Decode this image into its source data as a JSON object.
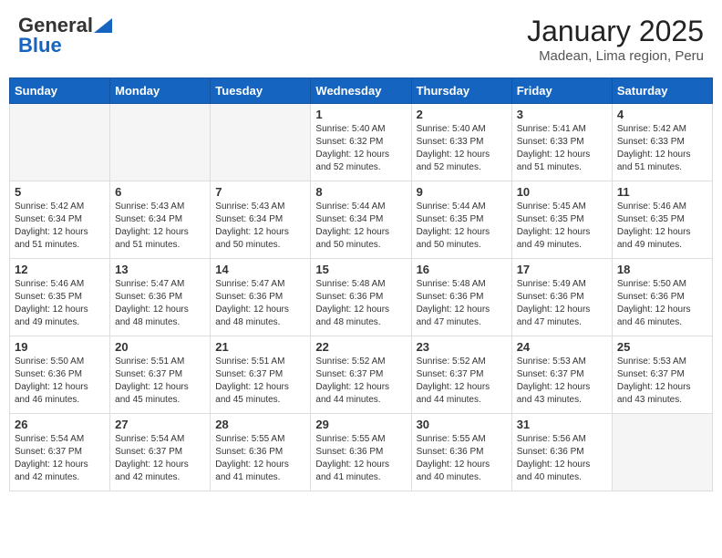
{
  "header": {
    "logo_general": "General",
    "logo_blue": "Blue",
    "month": "January 2025",
    "location": "Madean, Lima region, Peru"
  },
  "weekdays": [
    "Sunday",
    "Monday",
    "Tuesday",
    "Wednesday",
    "Thursday",
    "Friday",
    "Saturday"
  ],
  "weeks": [
    [
      {
        "day": "",
        "info": ""
      },
      {
        "day": "",
        "info": ""
      },
      {
        "day": "",
        "info": ""
      },
      {
        "day": "1",
        "info": "Sunrise: 5:40 AM\nSunset: 6:32 PM\nDaylight: 12 hours\nand 52 minutes."
      },
      {
        "day": "2",
        "info": "Sunrise: 5:40 AM\nSunset: 6:33 PM\nDaylight: 12 hours\nand 52 minutes."
      },
      {
        "day": "3",
        "info": "Sunrise: 5:41 AM\nSunset: 6:33 PM\nDaylight: 12 hours\nand 51 minutes."
      },
      {
        "day": "4",
        "info": "Sunrise: 5:42 AM\nSunset: 6:33 PM\nDaylight: 12 hours\nand 51 minutes."
      }
    ],
    [
      {
        "day": "5",
        "info": "Sunrise: 5:42 AM\nSunset: 6:34 PM\nDaylight: 12 hours\nand 51 minutes."
      },
      {
        "day": "6",
        "info": "Sunrise: 5:43 AM\nSunset: 6:34 PM\nDaylight: 12 hours\nand 51 minutes."
      },
      {
        "day": "7",
        "info": "Sunrise: 5:43 AM\nSunset: 6:34 PM\nDaylight: 12 hours\nand 50 minutes."
      },
      {
        "day": "8",
        "info": "Sunrise: 5:44 AM\nSunset: 6:34 PM\nDaylight: 12 hours\nand 50 minutes."
      },
      {
        "day": "9",
        "info": "Sunrise: 5:44 AM\nSunset: 6:35 PM\nDaylight: 12 hours\nand 50 minutes."
      },
      {
        "day": "10",
        "info": "Sunrise: 5:45 AM\nSunset: 6:35 PM\nDaylight: 12 hours\nand 49 minutes."
      },
      {
        "day": "11",
        "info": "Sunrise: 5:46 AM\nSunset: 6:35 PM\nDaylight: 12 hours\nand 49 minutes."
      }
    ],
    [
      {
        "day": "12",
        "info": "Sunrise: 5:46 AM\nSunset: 6:35 PM\nDaylight: 12 hours\nand 49 minutes."
      },
      {
        "day": "13",
        "info": "Sunrise: 5:47 AM\nSunset: 6:36 PM\nDaylight: 12 hours\nand 48 minutes."
      },
      {
        "day": "14",
        "info": "Sunrise: 5:47 AM\nSunset: 6:36 PM\nDaylight: 12 hours\nand 48 minutes."
      },
      {
        "day": "15",
        "info": "Sunrise: 5:48 AM\nSunset: 6:36 PM\nDaylight: 12 hours\nand 48 minutes."
      },
      {
        "day": "16",
        "info": "Sunrise: 5:48 AM\nSunset: 6:36 PM\nDaylight: 12 hours\nand 47 minutes."
      },
      {
        "day": "17",
        "info": "Sunrise: 5:49 AM\nSunset: 6:36 PM\nDaylight: 12 hours\nand 47 minutes."
      },
      {
        "day": "18",
        "info": "Sunrise: 5:50 AM\nSunset: 6:36 PM\nDaylight: 12 hours\nand 46 minutes."
      }
    ],
    [
      {
        "day": "19",
        "info": "Sunrise: 5:50 AM\nSunset: 6:36 PM\nDaylight: 12 hours\nand 46 minutes."
      },
      {
        "day": "20",
        "info": "Sunrise: 5:51 AM\nSunset: 6:37 PM\nDaylight: 12 hours\nand 45 minutes."
      },
      {
        "day": "21",
        "info": "Sunrise: 5:51 AM\nSunset: 6:37 PM\nDaylight: 12 hours\nand 45 minutes."
      },
      {
        "day": "22",
        "info": "Sunrise: 5:52 AM\nSunset: 6:37 PM\nDaylight: 12 hours\nand 44 minutes."
      },
      {
        "day": "23",
        "info": "Sunrise: 5:52 AM\nSunset: 6:37 PM\nDaylight: 12 hours\nand 44 minutes."
      },
      {
        "day": "24",
        "info": "Sunrise: 5:53 AM\nSunset: 6:37 PM\nDaylight: 12 hours\nand 43 minutes."
      },
      {
        "day": "25",
        "info": "Sunrise: 5:53 AM\nSunset: 6:37 PM\nDaylight: 12 hours\nand 43 minutes."
      }
    ],
    [
      {
        "day": "26",
        "info": "Sunrise: 5:54 AM\nSunset: 6:37 PM\nDaylight: 12 hours\nand 42 minutes."
      },
      {
        "day": "27",
        "info": "Sunrise: 5:54 AM\nSunset: 6:37 PM\nDaylight: 12 hours\nand 42 minutes."
      },
      {
        "day": "28",
        "info": "Sunrise: 5:55 AM\nSunset: 6:36 PM\nDaylight: 12 hours\nand 41 minutes."
      },
      {
        "day": "29",
        "info": "Sunrise: 5:55 AM\nSunset: 6:36 PM\nDaylight: 12 hours\nand 41 minutes."
      },
      {
        "day": "30",
        "info": "Sunrise: 5:55 AM\nSunset: 6:36 PM\nDaylight: 12 hours\nand 40 minutes."
      },
      {
        "day": "31",
        "info": "Sunrise: 5:56 AM\nSunset: 6:36 PM\nDaylight: 12 hours\nand 40 minutes."
      },
      {
        "day": "",
        "info": ""
      }
    ]
  ]
}
